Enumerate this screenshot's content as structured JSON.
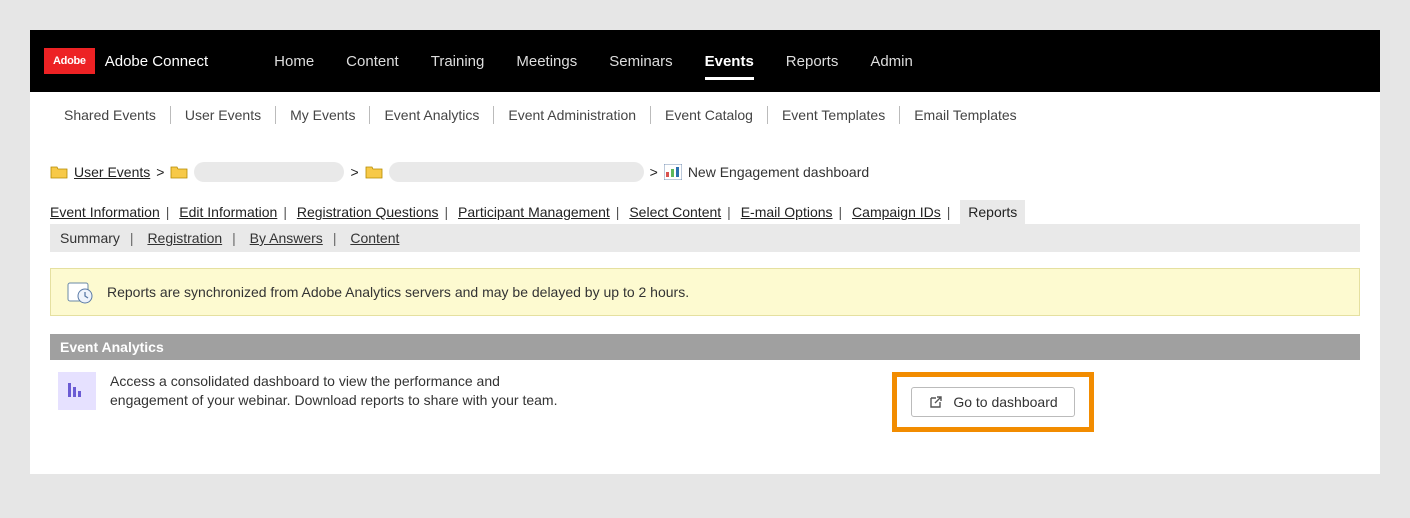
{
  "product": "Adobe Connect",
  "logo_text": "Adobe",
  "nav": [
    "Home",
    "Content",
    "Training",
    "Meetings",
    "Seminars",
    "Events",
    "Reports",
    "Admin"
  ],
  "nav_active": "Events",
  "subnav": [
    "Shared Events",
    "User Events",
    "My Events",
    "Event Analytics",
    "Event Administration",
    "Event Catalog",
    "Event Templates",
    "Email Templates"
  ],
  "breadcrumb": {
    "first": "User Events",
    "last": "New Engagement dashboard"
  },
  "tabs": [
    "Event Information",
    "Edit Information",
    "Registration Questions",
    "Participant Management",
    "Select Content",
    "E-mail Options",
    "Campaign IDs",
    "Reports"
  ],
  "tabs_active": "Reports",
  "subtabs": [
    "Summary",
    "Registration",
    "By Answers",
    "Content"
  ],
  "notice": "Reports are synchronized from Adobe Analytics servers and may be delayed by up to 2 hours.",
  "analytics": {
    "title": "Event Analytics",
    "desc": "Access a consolidated dashboard to view the performance and engagement of your webinar. Download reports to share with your team.",
    "button": "Go to dashboard"
  }
}
